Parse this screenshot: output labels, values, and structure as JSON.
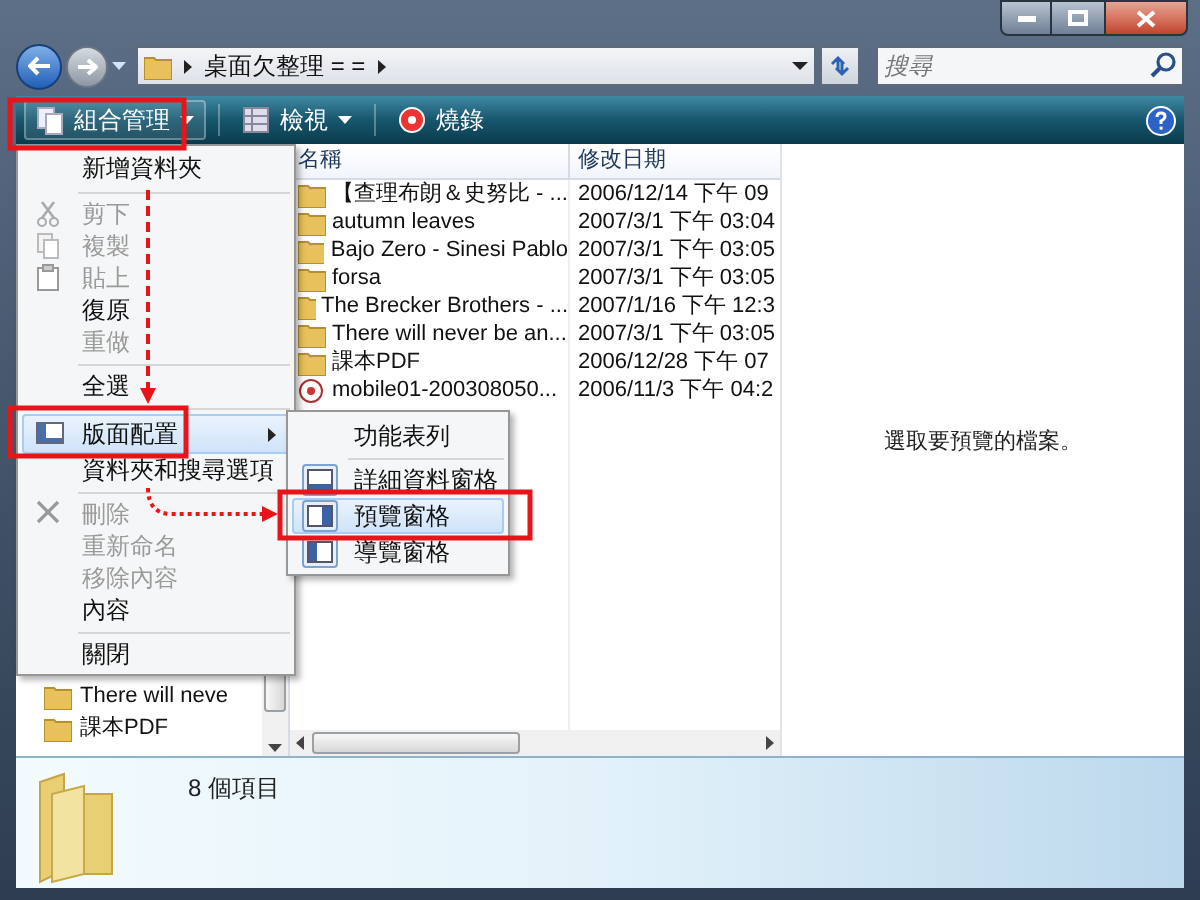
{
  "address_bar": {
    "path": [
      "桌面欠整理 = ="
    ]
  },
  "search": {
    "placeholder": "搜尋"
  },
  "toolbar": [
    {
      "label": "組合管理",
      "kind": "organize"
    },
    {
      "label": "檢視",
      "kind": "views"
    },
    {
      "label": "燒錄",
      "kind": "burn"
    }
  ],
  "navigation_pane": {
    "items": [
      {
        "label": "There will neve",
        "kind": "folder"
      },
      {
        "label": "課本PDF",
        "kind": "folder"
      }
    ]
  },
  "file_list": {
    "columns": [
      "名稱",
      "修改日期"
    ],
    "rows": [
      {
        "name": "【查理布朗＆史努比 - ...",
        "modified": "2006/12/14 下午 09",
        "kind": "folder"
      },
      {
        "name": "autumn leaves",
        "modified": "2007/3/1 下午 03:04",
        "kind": "folder"
      },
      {
        "name": "Bajo Zero - Sinesi Pablo",
        "modified": "2007/3/1 下午 03:05",
        "kind": "folder"
      },
      {
        "name": "forsa",
        "modified": "2007/3/1 下午 03:05",
        "kind": "folder"
      },
      {
        "name": "The Brecker Brothers - ...",
        "modified": "2007/1/16 下午 12:3",
        "kind": "folder"
      },
      {
        "name": "There will never be an...",
        "modified": "2007/3/1 下午 03:05",
        "kind": "folder"
      },
      {
        "name": "課本PDF",
        "modified": "2006/12/28 下午 07",
        "kind": "folder"
      },
      {
        "name": "mobile01-200308050...",
        "modified": "2006/11/3 下午 04:2",
        "kind": "file"
      }
    ]
  },
  "preview_pane": {
    "message": "選取要預覽的檔案。"
  },
  "details_pane": {
    "item_count": "8 個項目"
  },
  "organize_menu": {
    "items": [
      {
        "label": "新增資料夾",
        "kind": "plain",
        "disabled": false,
        "selected": false
      },
      {
        "kind": "separator"
      },
      {
        "label": "剪下",
        "kind": "cut",
        "disabled": true,
        "selected": false
      },
      {
        "label": "複製",
        "kind": "copy",
        "disabled": true,
        "selected": false
      },
      {
        "label": "貼上",
        "kind": "paste",
        "disabled": true,
        "selected": false
      },
      {
        "label": "復原",
        "kind": "plain",
        "disabled": false,
        "selected": false
      },
      {
        "label": "重做",
        "kind": "plain",
        "disabled": true,
        "selected": false
      },
      {
        "kind": "separator"
      },
      {
        "label": "全選",
        "kind": "plain",
        "disabled": false,
        "selected": false
      },
      {
        "kind": "separator"
      },
      {
        "label": "版面配置",
        "kind": "layout",
        "disabled": false,
        "selected": true
      },
      {
        "label": "資料夾和搜尋選項",
        "kind": "plain",
        "disabled": false,
        "selected": false
      },
      {
        "kind": "separator"
      },
      {
        "label": "刪除",
        "kind": "delete",
        "disabled": true,
        "selected": false
      },
      {
        "label": "重新命名",
        "kind": "plain",
        "disabled": true,
        "selected": false
      },
      {
        "label": "移除內容",
        "kind": "plain",
        "disabled": true,
        "selected": false
      },
      {
        "label": "內容",
        "kind": "plain",
        "disabled": false,
        "selected": false
      },
      {
        "kind": "separator"
      },
      {
        "label": "關閉",
        "kind": "plain",
        "disabled": false,
        "selected": false
      }
    ]
  },
  "layout_submenu": {
    "items": [
      {
        "label": "功能表列",
        "checked": false,
        "selected": false
      },
      {
        "label": "詳細資料窗格",
        "kind": "details",
        "checked": true,
        "selected": false
      },
      {
        "label": "預覽窗格",
        "kind": "preview",
        "checked": true,
        "selected": true
      },
      {
        "label": "導覽窗格",
        "kind": "navigation",
        "checked": true,
        "selected": false
      }
    ]
  }
}
